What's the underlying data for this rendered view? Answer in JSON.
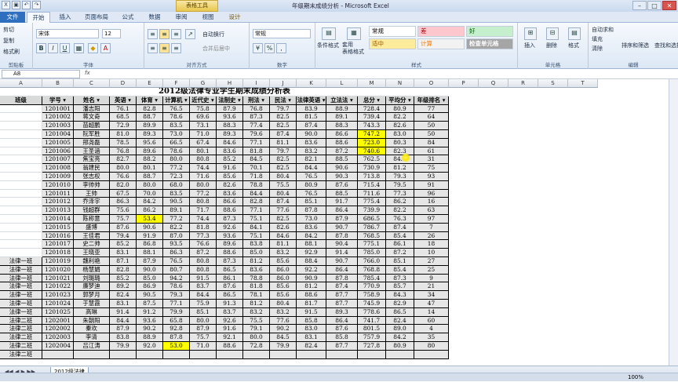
{
  "window": {
    "title": "年级期末成绩分析 - Microsoft Excel",
    "context_tab": "表格工具",
    "controls": [
      "–",
      "□",
      "✕"
    ]
  },
  "tabs": [
    "文件",
    "开始",
    "插入",
    "页面布局",
    "公式",
    "数据",
    "审阅",
    "视图",
    "设计"
  ],
  "active_tab": "开始",
  "ribbon": {
    "clipboard": {
      "cut": "剪切",
      "copy": "复制",
      "format_painter": "格式刷",
      "label": "剪贴板"
    },
    "font": {
      "name": "宋体",
      "size": "12",
      "label": "字体"
    },
    "alignment": {
      "wrap": "自动换行",
      "merge": "合并后居中",
      "label": "对齐方式"
    },
    "number": {
      "format": "常规",
      "label": "数字"
    },
    "styles": {
      "cond": "条件格式",
      "table": "套用\n表格格式",
      "s1": "常规",
      "s2": "差",
      "s3": "好",
      "s4": "适中",
      "s5": "计算",
      "s6": "检查单元格",
      "label": "样式"
    },
    "cells": {
      "insert": "插入",
      "delete": "删除",
      "format": "格式",
      "label": "单元格"
    },
    "editing": {
      "autosum": "自动求和",
      "fill": "填充",
      "clear": "清除",
      "sort": "排序和筛选",
      "find": "查找和选择",
      "label": "编辑"
    }
  },
  "formula_bar": {
    "name_box": "A8",
    "fx": "fx",
    "content": ""
  },
  "columns": [
    "A",
    "B",
    "C",
    "D",
    "E",
    "F",
    "G",
    "H",
    "I",
    "J",
    "K",
    "L",
    "M",
    "N",
    "O",
    "P",
    "Q",
    "R",
    "S",
    "T"
  ],
  "sheet_title": "2012级法律专业学生期末成绩分析表",
  "headers": [
    "班级",
    "学号",
    "姓名",
    "英语",
    "体育",
    "计算机",
    "近代史",
    "法制史",
    "刑法",
    "民法",
    "法律英语",
    "立法法",
    "总分",
    "平均分",
    "年级排名"
  ],
  "rows": [
    [
      "",
      "1201001",
      "潘志阳",
      "76.1",
      "82.8",
      "76.5",
      "75.8",
      "87.9",
      "76.8",
      "79.7",
      "83.9",
      "88.9",
      "728.4",
      "80.9",
      "77"
    ],
    [
      "",
      "1201002",
      "蒋文奇",
      "68.5",
      "88.7",
      "78.6",
      "69.6",
      "93.6",
      "87.3",
      "82.5",
      "81.5",
      "89.1",
      "739.4",
      "82.2",
      "64"
    ],
    [
      "",
      "1201003",
      "苗超鹏",
      "72.9",
      "89.9",
      "83.5",
      "73.1",
      "88.3",
      "77.4",
      "82.5",
      "87.4",
      "88.3",
      "743.3",
      "82.6",
      "50"
    ],
    [
      "",
      "1201004",
      "阮军胜",
      "81.0",
      "89.3",
      "73.0",
      "71.0",
      "89.3",
      "79.6",
      "87.4",
      "90.0",
      "86.6",
      "747.2",
      "83.0",
      "50"
    ],
    [
      "",
      "1201005",
      "邢尧磊",
      "78.5",
      "95.6",
      "66.5",
      "67.4",
      "84.6",
      "77.1",
      "81.1",
      "83.6",
      "88.6",
      "723.0",
      "80.3",
      "84"
    ],
    [
      "",
      "1201006",
      "王圣涵",
      "76.8",
      "89.6",
      "78.6",
      "80.1",
      "83.6",
      "81.8",
      "79.7",
      "83.2",
      "87.2",
      "740.6",
      "82.3",
      "61"
    ],
    [
      "",
      "1201007",
      "焦宝亮",
      "82.7",
      "88.2",
      "80.0",
      "80.8",
      "85.2",
      "84.5",
      "82.5",
      "82.1",
      "88.5",
      "762.5",
      "84.7",
      "31"
    ],
    [
      "",
      "1201008",
      "翁建民",
      "80.0",
      "80.1",
      "77.2",
      "74.4",
      "91.6",
      "70.1",
      "82.5",
      "84.4",
      "90.6",
      "730.9",
      "81.2",
      "75"
    ],
    [
      "",
      "1201009",
      "张志权",
      "76.6",
      "88.7",
      "72.3",
      "71.6",
      "85.6",
      "71.8",
      "80.4",
      "76.5",
      "90.3",
      "713.8",
      "79.3",
      "93"
    ],
    [
      "",
      "1201010",
      "李帅帅",
      "82.0",
      "80.0",
      "68.0",
      "80.0",
      "82.6",
      "78.8",
      "75.5",
      "80.9",
      "87.6",
      "715.4",
      "79.5",
      "91"
    ],
    [
      "",
      "1201011",
      "王帅",
      "67.5",
      "70.0",
      "83.5",
      "77.2",
      "83.6",
      "84.4",
      "80.4",
      "76.5",
      "88.5",
      "711.6",
      "77.3",
      "96"
    ],
    [
      "",
      "1201012",
      "乔泽宇",
      "86.3",
      "84.2",
      "90.5",
      "80.8",
      "86.6",
      "82.8",
      "87.4",
      "85.1",
      "91.7",
      "775.4",
      "86.2",
      "16"
    ],
    [
      "",
      "1201013",
      "钱超群",
      "75.6",
      "86.2",
      "89.1",
      "71.7",
      "88.6",
      "77.1",
      "77.6",
      "87.8",
      "86.4",
      "739.9",
      "82.2",
      "63"
    ],
    [
      "",
      "1201014",
      "陈称意",
      "75.7",
      "53.4",
      "77.2",
      "74.4",
      "87.3",
      "75.1",
      "82.5",
      "73.0",
      "87.9",
      "686.5",
      "76.3",
      "97"
    ],
    [
      "",
      "1201015",
      "盛博",
      "87.6",
      "90.6",
      "82.2",
      "81.8",
      "92.6",
      "84.1",
      "82.6",
      "83.6",
      "90.7",
      "786.7",
      "87.4",
      "7"
    ],
    [
      "",
      "1201016",
      "王佳君",
      "79.4",
      "91.9",
      "87.0",
      "77.3",
      "93.6",
      "75.1",
      "84.6",
      "84.2",
      "87.8",
      "768.5",
      "85.4",
      "26"
    ],
    [
      "",
      "1201017",
      "史二帅",
      "85.2",
      "86.8",
      "93.5",
      "76.6",
      "89.6",
      "83.8",
      "81.1",
      "88.1",
      "90.4",
      "775.1",
      "86.1",
      "18"
    ],
    [
      "",
      "1201018",
      "王晓亚",
      "83.1",
      "88.1",
      "86.3",
      "87.2",
      "88.6",
      "85.0",
      "83.2",
      "92.9",
      "91.4",
      "785.0",
      "87.2",
      "10"
    ],
    [
      "法律一班",
      "1201019",
      "魏利艳",
      "87.1",
      "87.9",
      "76.5",
      "80.8",
      "87.3",
      "81.2",
      "85.6",
      "88.4",
      "90.7",
      "766.0",
      "85.1",
      "27"
    ],
    [
      "法律一班",
      "1201020",
      "杨慧娟",
      "82.8",
      "90.0",
      "80.7",
      "80.8",
      "86.5",
      "83.6",
      "86.0",
      "92.2",
      "86.4",
      "768.8",
      "85.4",
      "25"
    ],
    [
      "法律一班",
      "1201021",
      "刘璐璐",
      "85.2",
      "85.0",
      "94.2",
      "91.5",
      "86.1",
      "78.8",
      "86.0",
      "90.9",
      "87.8",
      "785.4",
      "87.3",
      "9"
    ],
    [
      "法律一班",
      "1201022",
      "廉梦迪",
      "89.2",
      "86.9",
      "78.6",
      "83.7",
      "87.6",
      "81.8",
      "85.6",
      "81.2",
      "87.4",
      "770.9",
      "85.7",
      "21"
    ],
    [
      "法律一班",
      "1201023",
      "郭梦月",
      "82.4",
      "90.5",
      "79.3",
      "84.4",
      "86.5",
      "78.1",
      "85.6",
      "88.6",
      "87.7",
      "758.9",
      "84.3",
      "34"
    ],
    [
      "法律一班",
      "1201024",
      "于慧霞",
      "83.1",
      "87.5",
      "77.1",
      "75.9",
      "91.3",
      "81.2",
      "80.4",
      "81.7",
      "87.7",
      "745.9",
      "82.9",
      "47"
    ],
    [
      "法律一班",
      "1201025",
      "高琳",
      "91.4",
      "91.2",
      "79.9",
      "85.1",
      "83.7",
      "83.2",
      "83.2",
      "91.5",
      "89.3",
      "778.6",
      "86.5",
      "14"
    ],
    [
      "法律二班",
      "1202001",
      "朱朝阳",
      "84.4",
      "93.6",
      "65.8",
      "80.0",
      "92.6",
      "75.5",
      "77.6",
      "85.8",
      "86.4",
      "741.7",
      "82.4",
      "60"
    ],
    [
      "法律二班",
      "1202002",
      "秦欢",
      "87.9",
      "90.2",
      "92.8",
      "87.9",
      "91.6",
      "79.1",
      "90.2",
      "83.0",
      "87.6",
      "801.5",
      "89.0",
      "4"
    ],
    [
      "法律二班",
      "1202003",
      "李清",
      "83.8",
      "88.9",
      "87.8",
      "75.7",
      "92.1",
      "80.0",
      "84.5",
      "83.1",
      "85.8",
      "757.9",
      "84.2",
      "35"
    ],
    [
      "法律二班",
      "1202004",
      "吕江涛",
      "79.9",
      "92.0",
      "53.0",
      "71.0",
      "88.6",
      "72.8",
      "79.9",
      "82.4",
      "87.7",
      "727.8",
      "80.9",
      "80"
    ],
    [
      "法律二班",
      "",
      "",
      "",
      "",
      "",
      "",
      "",
      "",
      "",
      "",
      "",
      "",
      "",
      ""
    ]
  ],
  "highlights": [
    [
      "1201014",
      4
    ],
    [
      "1201004",
      12
    ],
    [
      "1201005",
      12
    ],
    [
      "1201006",
      12
    ],
    [
      "1202004",
      5
    ]
  ],
  "sheet_tabs": [
    "2012级法律"
  ],
  "sheet_nav": [
    "◀◀",
    "◀",
    "▶",
    "▶▶"
  ],
  "status": {
    "zoom": "100%"
  }
}
